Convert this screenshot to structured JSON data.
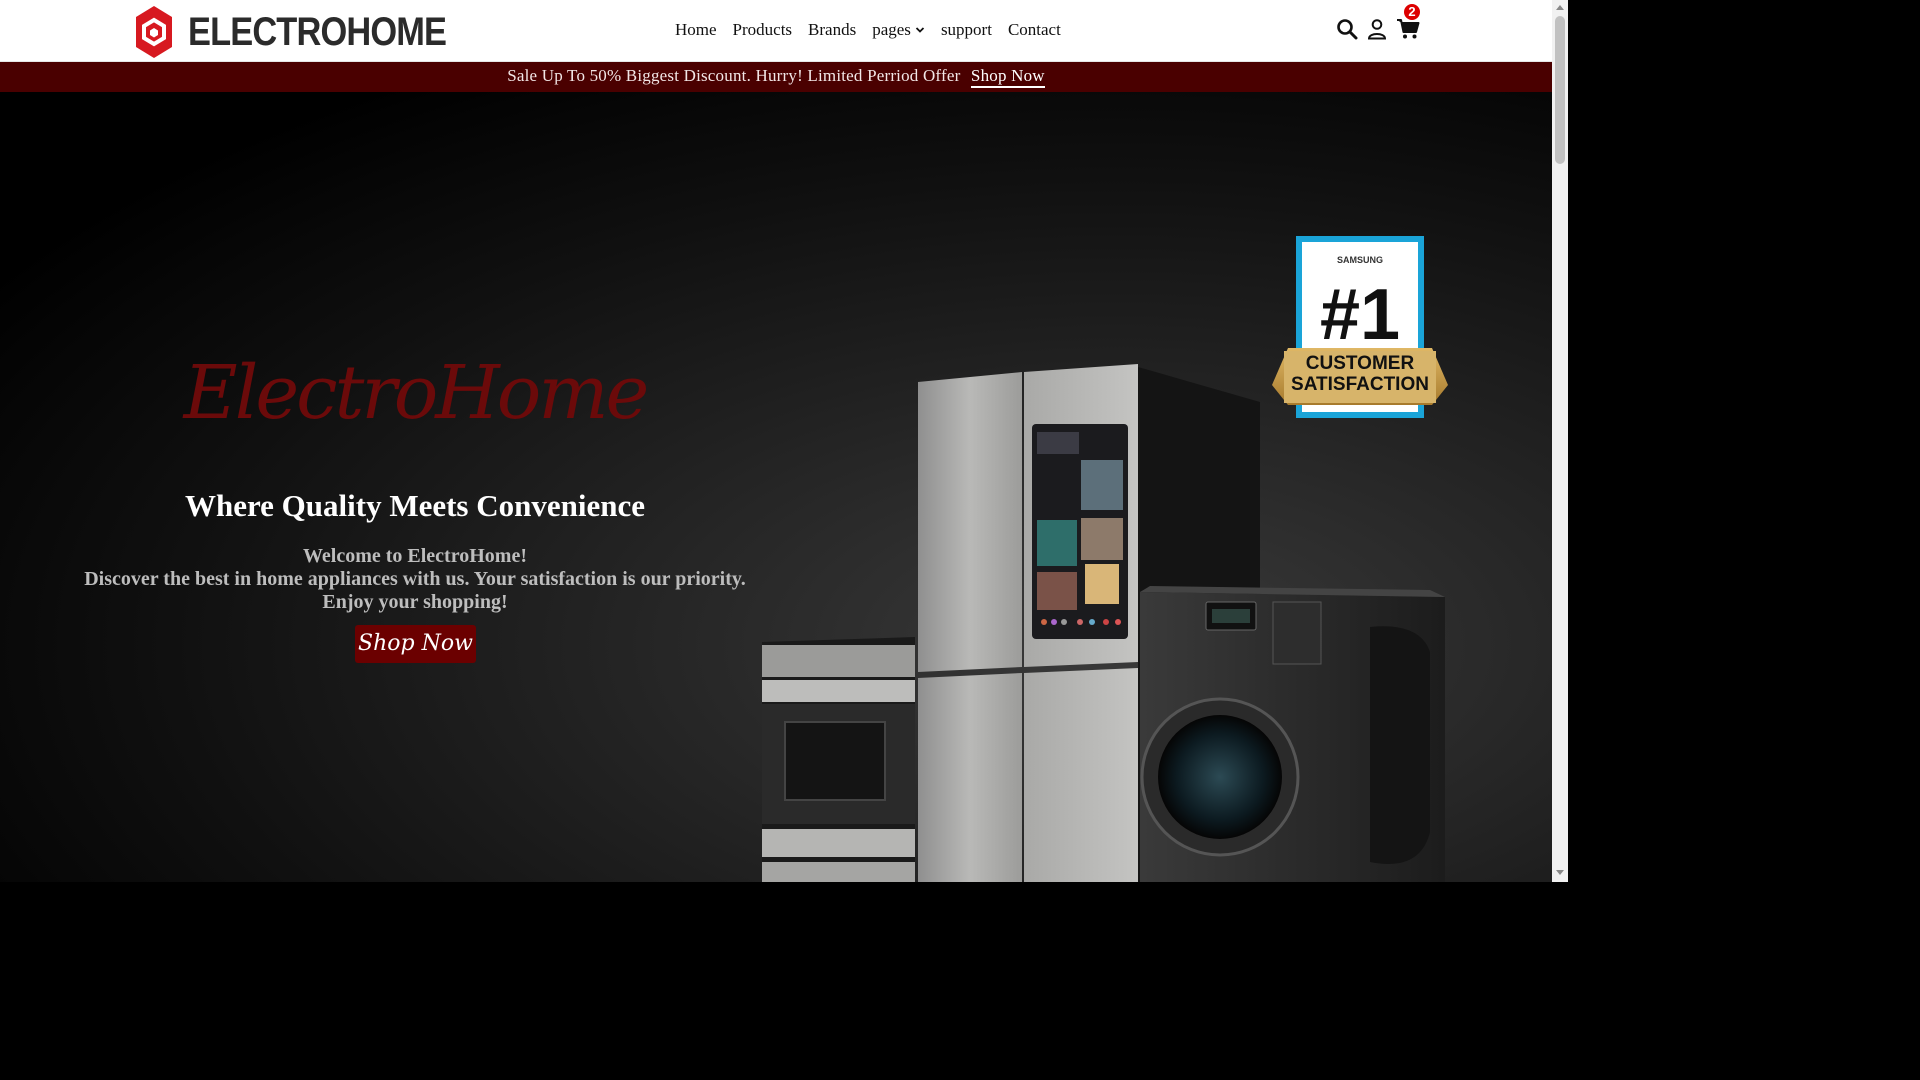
{
  "header": {
    "logo_text": "ELECTROHOME",
    "nav": [
      {
        "label": "Home"
      },
      {
        "label": "Products"
      },
      {
        "label": "Brands"
      },
      {
        "label": "pages",
        "has_dropdown": true
      },
      {
        "label": "support"
      },
      {
        "label": "Contact"
      }
    ],
    "icons": [
      "search-icon",
      "user-icon",
      "cart-icon"
    ],
    "cart_count": "2"
  },
  "promo": {
    "text": "Sale Up To 50% Biggest Discount. Hurry! Limited Perriod Offer",
    "link_label": "Shop Now"
  },
  "hero": {
    "brand_script": "ElectroHome",
    "tagline": "Where Quality Meets Convenience",
    "welcome_lines": [
      "Welcome to ElectroHome!",
      "Discover the best in home appliances with us. Your satisfaction is our priority.",
      "Enjoy your shopping!"
    ],
    "cta_label": "Shop Now",
    "badge": {
      "brand": "SAMSUNG",
      "rank": "#1",
      "line1": "CUSTOMER",
      "line2": "SATISFACTION"
    }
  },
  "colors": {
    "brand_red": "#d71920",
    "promo_bg": "#4a0000",
    "cta_bg": "#6b0000",
    "script_red": "#6b0a0a"
  }
}
